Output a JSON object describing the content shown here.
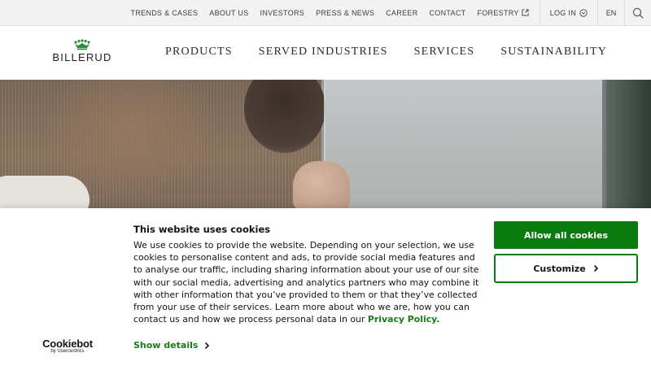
{
  "topbar": {
    "links": [
      {
        "label": "TRENDS & CASES"
      },
      {
        "label": "ABOUT US"
      },
      {
        "label": "INVESTORS"
      },
      {
        "label": "PRESS & NEWS"
      },
      {
        "label": "CAREER"
      },
      {
        "label": "CONTACT"
      },
      {
        "label": "FORESTRY",
        "icon": "external-link-icon"
      }
    ],
    "login_label": "LOG IN",
    "login_icon": "chevron-down-circle-icon",
    "language": "EN",
    "search_icon": "search-icon"
  },
  "header": {
    "logo_text": "BILLERUD",
    "logo_icon": "crown-icon",
    "nav": [
      {
        "label": "PRODUCTS"
      },
      {
        "label": "SERVED INDUSTRIES"
      },
      {
        "label": "SERVICES"
      },
      {
        "label": "SUSTAINABILITY"
      }
    ]
  },
  "cookie_banner": {
    "title": "This website uses cookies",
    "body": "We use cookies to provide the website. Depending on your selection, we use cookies to personalise content and ads, to provide social media features and to analyse our traffic, including sharing information about your use of our site with our social media, advertising and analytics partners who may combine it with other information that you’ve provided to them or that they’ve collected from your use of their services. Learn more about who we are, how you can contact us and how we process personal data in our ",
    "privacy_link": "Privacy Policy.",
    "show_details": "Show details",
    "allow_all": "Allow all cookies",
    "customize": "Customize",
    "brand_word": "Cookiebot",
    "brand_sub": "by Usercentrics"
  },
  "colors": {
    "accent_green": "#0a7c0f",
    "link_green": "#1a7a1a",
    "topbar_bg": "#f3f3f3",
    "logo_green": "#2e8b3a"
  }
}
